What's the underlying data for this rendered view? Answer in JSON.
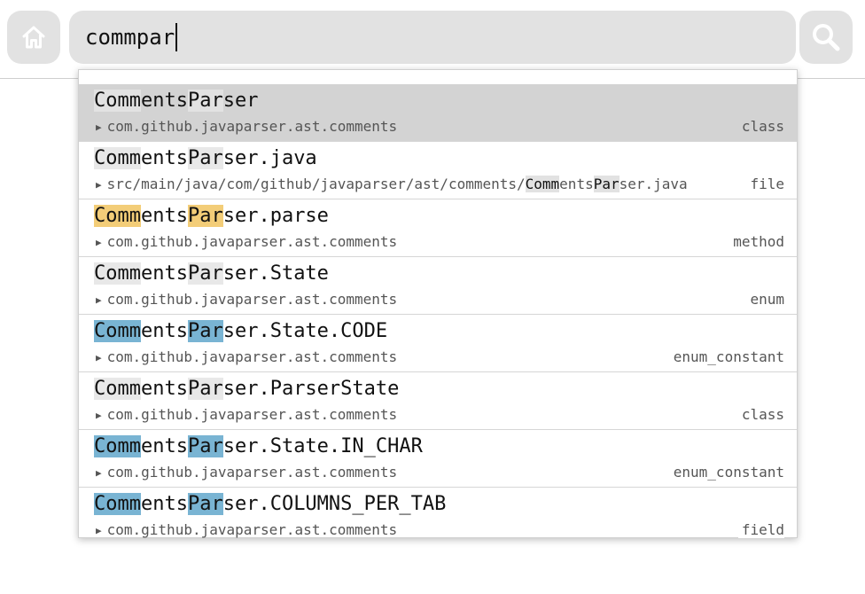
{
  "search": {
    "query": "commpar"
  },
  "items": [
    {
      "title": [
        "Comm",
        "ents",
        "Par",
        "ser"
      ],
      "path": "com.github.javaparser.ast.comments",
      "kind": "class",
      "highlight": "gray",
      "selected": true
    },
    {
      "title": [
        "Comm",
        "ents",
        "Par",
        "ser.java"
      ],
      "path_parts": [
        "src/main/java/com/github/javaparser/ast/comments/",
        "Comm",
        "ents",
        "Par",
        "ser.java"
      ],
      "kind": "file",
      "highlight": "gray"
    },
    {
      "title": [
        "Comm",
        "ents",
        "Par",
        "ser.parse"
      ],
      "path": "com.github.javaparser.ast.comments",
      "kind": "method",
      "highlight": "yellow"
    },
    {
      "title": [
        "Comm",
        "ents",
        "Par",
        "ser.State"
      ],
      "path": "com.github.javaparser.ast.comments",
      "kind": "enum",
      "highlight": "gray"
    },
    {
      "title": [
        "Comm",
        "ents",
        "Par",
        "ser.State.CODE"
      ],
      "path": "com.github.javaparser.ast.comments",
      "kind": "enum_constant",
      "highlight": "blue"
    },
    {
      "title": [
        "Comm",
        "ents",
        "Par",
        "ser.ParserState"
      ],
      "path": "com.github.javaparser.ast.comments",
      "kind": "class",
      "highlight": "gray"
    },
    {
      "title": [
        "Comm",
        "ents",
        "Par",
        "ser.State.IN_CHAR"
      ],
      "path": "com.github.javaparser.ast.comments",
      "kind": "enum_constant",
      "highlight": "blue"
    },
    {
      "title": [
        "Comm",
        "ents",
        "Par",
        "ser.COLUMNS_PER_TAB"
      ],
      "path": "com.github.javaparser.ast.comments",
      "kind": "field",
      "highlight": "blue"
    }
  ],
  "colors": {
    "highlight_gray": "#e8e8e8",
    "highlight_yellow": "#f3cd78",
    "highlight_blue": "#79b4d3",
    "selected_row": "#d3d3d3",
    "button_bg": "#e2e2e2"
  },
  "icons": {
    "home": "home-icon",
    "search": "search-icon",
    "expand": "triangle-right-icon"
  }
}
